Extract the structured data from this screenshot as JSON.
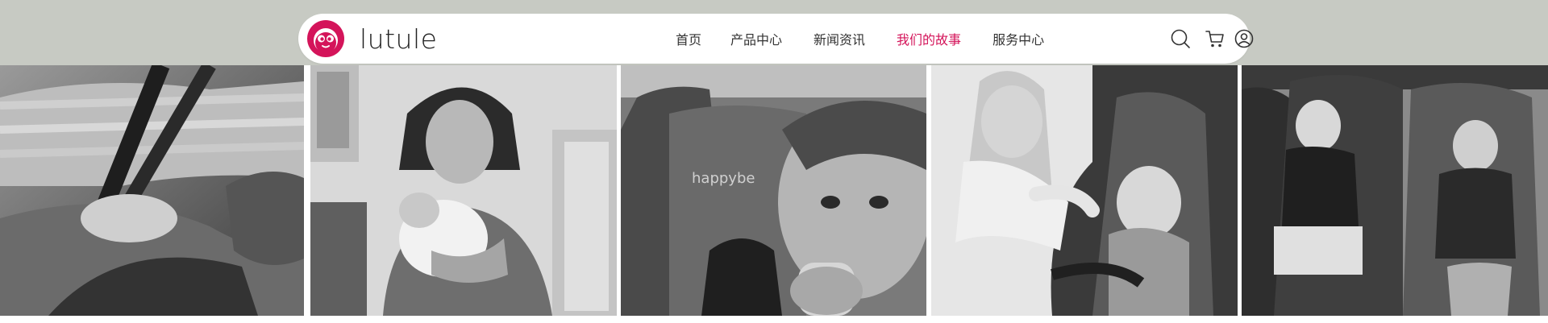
{
  "brand": {
    "name": "lutule",
    "accent_color": "#d4145a",
    "logo_icon": "lutule-face-logo-icon"
  },
  "nav": {
    "items": [
      {
        "label": "首页",
        "active": false
      },
      {
        "label": "产品中心",
        "active": false
      },
      {
        "label": "新闻资讯",
        "active": false
      },
      {
        "label": "我们的故事",
        "active": true
      },
      {
        "label": "服务中心",
        "active": false
      }
    ]
  },
  "header_icons": {
    "search": "search-icon",
    "cart": "cart-icon",
    "account": "user-icon"
  },
  "gallery": {
    "photos": [
      {
        "name": "photo-seatbelt-closeup"
      },
      {
        "name": "photo-mother-holding-newborn"
      },
      {
        "name": "photo-toddler-drinking-in-seat",
        "seat_label": "happybe"
      },
      {
        "name": "photo-mother-kissing-baby-foot"
      },
      {
        "name": "photo-two-children-in-car-seats"
      }
    ]
  }
}
